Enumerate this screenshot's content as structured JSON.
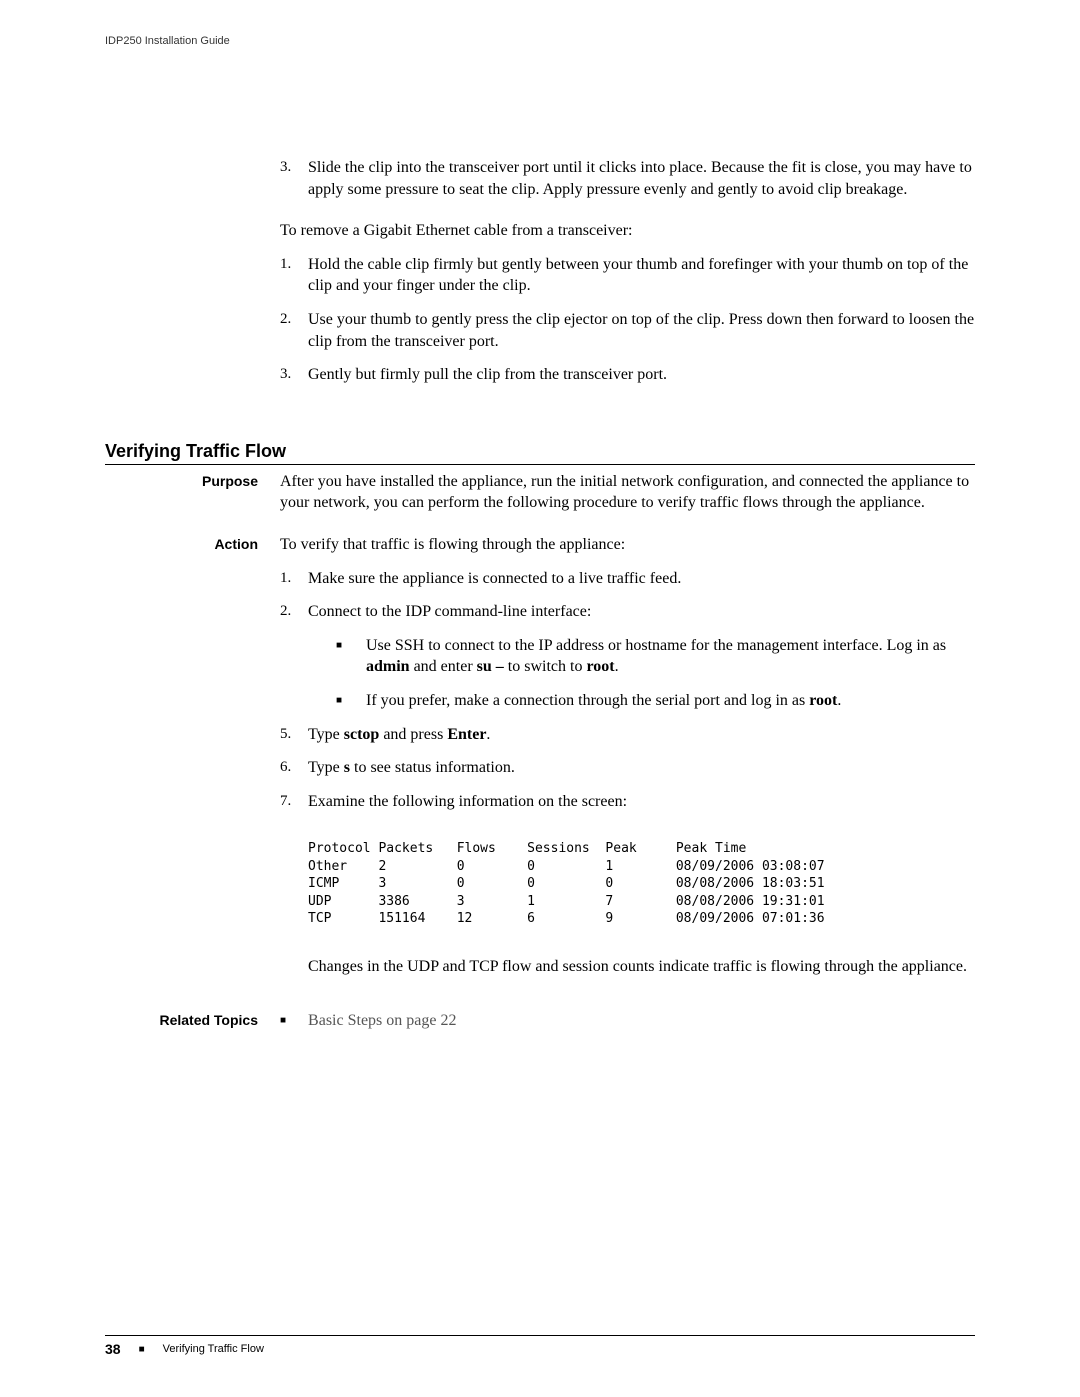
{
  "header": {
    "title": "IDP250 Installation Guide"
  },
  "intro": {
    "items": [
      "Slide the clip into the transceiver port until it clicks into place. Because the fit is close, you may have to apply some pressure to seat the clip. Apply pressure evenly and gently to avoid clip breakage."
    ],
    "remove_intro": "To remove a Gigabit Ethernet cable from a transceiver:",
    "remove_steps": [
      "Hold the cable clip firmly but gently between your thumb and forefinger with your thumb on top of the clip and your finger under the clip.",
      "Use your thumb to gently press the clip ejector on top of the clip. Press down then forward to loosen the clip from the transceiver port.",
      "Gently but firmly pull the clip from the transceiver port."
    ]
  },
  "section": {
    "heading": "Verifying Traffic Flow"
  },
  "purpose": {
    "label": "Purpose",
    "text": "After you have installed the appliance, run the initial network configuration, and connected the appliance to your network, you can perform the following procedure to verify traffic flows through the appliance."
  },
  "action": {
    "label": "Action",
    "intro": "To verify that traffic is flowing through the appliance:",
    "step1": "Make sure the appliance is connected to a live traffic feed.",
    "step2": "Connect to the IDP command-line interface:",
    "bullet1_a": "Use SSH to connect to the IP address or hostname for the management interface. Log in as ",
    "bullet1_b": "admin",
    "bullet1_c": " and enter ",
    "bullet1_d": "su –",
    "bullet1_e": " to switch to ",
    "bullet1_f": "root",
    "bullet1_g": ".",
    "bullet2_a": "If you prefer, make a connection through the serial port and log in as ",
    "bullet2_b": "root",
    "bullet2_c": ".",
    "step3_a": "Type  ",
    "step3_b": "sctop",
    "step3_c": " and press ",
    "step3_d": "Enter",
    "step3_e": ".",
    "step4_a": "Type ",
    "step4_b": "s",
    "step4_c": " to see status information.",
    "step5": "Examine the following information on the screen:",
    "note": "Changes in the UDP and TCP flow and session counts indicate traffic is flowing through the appliance."
  },
  "chart_data": {
    "type": "table",
    "columns": [
      "Protocol",
      "Packets",
      "Flows",
      "Sessions",
      "Peak",
      "Peak Time"
    ],
    "rows": [
      [
        "Other",
        "2",
        "0",
        "0",
        "1",
        "08/09/2006 03:08:07"
      ],
      [
        "ICMP",
        "3",
        "0",
        "0",
        "0",
        "08/08/2006 18:03:51"
      ],
      [
        "UDP",
        "3386",
        "3",
        "1",
        "7",
        "08/08/2006 19:31:01"
      ],
      [
        "TCP",
        "151164",
        "12",
        "6",
        "9",
        "08/09/2006 07:01:36"
      ]
    ]
  },
  "related": {
    "label": "Related Topics",
    "link": "Basic Steps on page 22"
  },
  "footer": {
    "page": "38",
    "text": "Verifying Traffic Flow"
  }
}
